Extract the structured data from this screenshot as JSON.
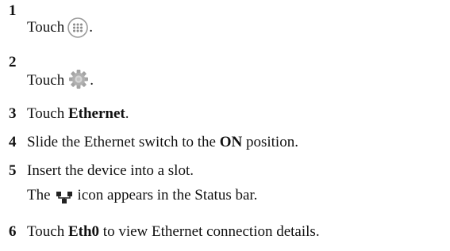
{
  "steps": [
    {
      "number": "1",
      "text_before": "Touch",
      "icon": "apps-grid-icon",
      "text_after": "."
    },
    {
      "number": "2",
      "text_before": "Touch",
      "icon": "settings-gear-icon",
      "text_after": "."
    },
    {
      "number": "3",
      "text_before": "Touch ",
      "bold": "Ethernet",
      "text_after": "."
    },
    {
      "number": "4",
      "text_before": "Slide the Ethernet switch to the ",
      "bold": "ON",
      "text_after": " position."
    },
    {
      "number": "5",
      "text": "Insert the device into a slot.",
      "sub_before": "The",
      "sub_icon": "ethernet-status-icon",
      "sub_after": "icon appears in the Status bar."
    },
    {
      "number": "6",
      "text_before": "Touch ",
      "bold": "Eth0",
      "text_after": " to view Ethernet connection details."
    }
  ]
}
